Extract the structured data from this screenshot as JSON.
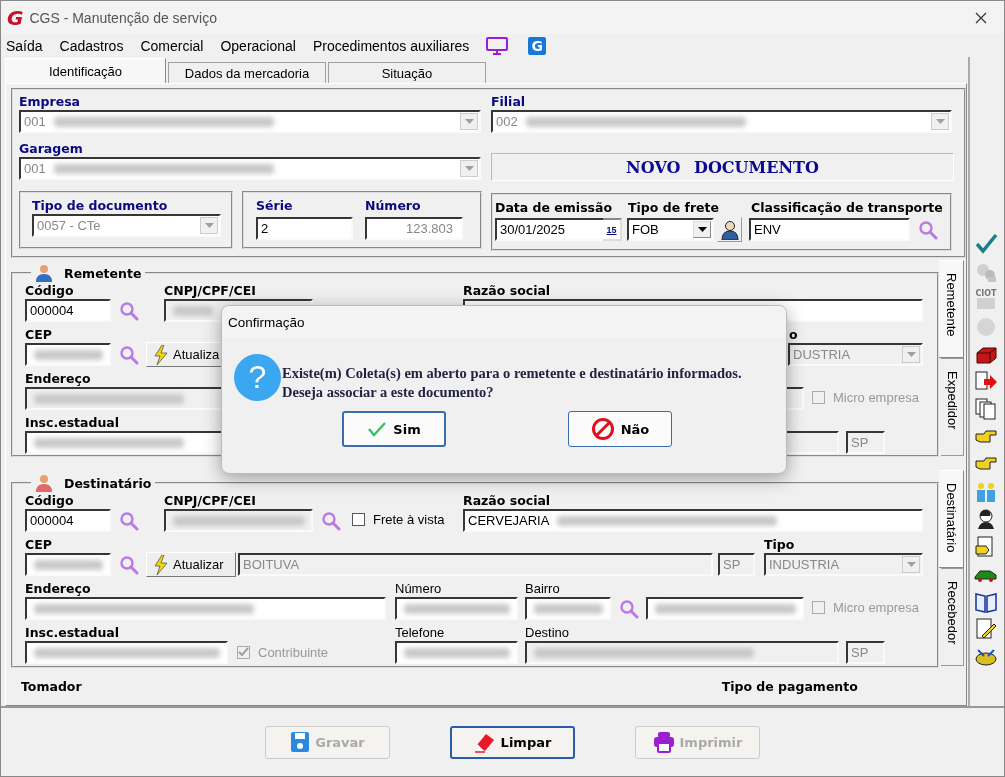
{
  "window": {
    "logo": "G",
    "title": "CGS - Manutenção de serviço"
  },
  "menu": [
    "Saída",
    "Cadastros",
    "Comercial",
    "Operacional",
    "Procedimentos auxiliares"
  ],
  "menu_logo": "G",
  "tabs": [
    {
      "label": "Identificação",
      "selected": true
    },
    {
      "label": "Dados da mercadoria",
      "selected": false
    },
    {
      "label": "Situação",
      "selected": false
    }
  ],
  "empresa": {
    "label": "Empresa",
    "field": {
      "value": "001",
      "redacted": true,
      "disabled": true
    }
  },
  "filial": {
    "label": "Filial",
    "field": {
      "value": "002",
      "redacted": true,
      "disabled": true
    }
  },
  "garagem": {
    "label": "Garagem",
    "field": {
      "value": "001",
      "redacted": true,
      "disabled": true
    }
  },
  "status_banner": "NOVO DOCUMENTO",
  "document_type": {
    "label": "Tipo de documento",
    "field": {
      "value": "0057 - CTe",
      "disabled": true
    }
  },
  "serie": {
    "label": "Série",
    "field": {
      "value": "2",
      "disabled": false
    }
  },
  "numero": {
    "label": "Número",
    "field": {
      "value": "123.803",
      "disabled": true
    }
  },
  "emission_date": {
    "label": "Data de emissão",
    "field": {
      "value": "30/01/2025",
      "disabled": false
    },
    "calendar_day": "15"
  },
  "freight_type": {
    "label": "Tipo de frete",
    "field": {
      "value": "FOB",
      "disabled": false
    }
  },
  "transport_class": {
    "label": "Classificação de transporte",
    "field": {
      "value": "ENV",
      "disabled": false
    }
  },
  "remetente": {
    "title": "Remetente",
    "codigo_label": "Código",
    "codigo": {
      "value": "000004",
      "disabled": false
    },
    "cnpj_label": "CNPJ/CPF/CEI",
    "cnpj": {
      "redacted": true,
      "disabled": true
    },
    "razao_label": "Razão social",
    "razao": {
      "disabled": false
    },
    "cep_label": "CEP",
    "cep": {
      "redacted": true,
      "disabled": false
    },
    "update_button": "Atualiza",
    "tipo_label": "o",
    "tipo": {
      "value": "DUSTRIA",
      "disabled": true
    },
    "endereco_label": "Endereço",
    "endereco": {
      "redacted": true,
      "disabled": true
    },
    "bairro_nome": {
      "disabled": true
    },
    "micro": {
      "label": "Micro empresa",
      "checked": false,
      "disabled": true
    },
    "insc_label": "Insc.estadual",
    "insc": {
      "redacted": true,
      "disabled": false
    },
    "destino": {
      "disabled": true
    },
    "uf": {
      "value": "SP",
      "disabled": true
    },
    "side_tabs": [
      {
        "label": "Remetente",
        "selected": true
      },
      {
        "label": "Expedidor",
        "selected": false
      }
    ]
  },
  "destinatario": {
    "title": "Destinatário",
    "codigo_label": "Código",
    "codigo": {
      "value": "000004",
      "disabled": false
    },
    "cnpj_label": "CNPJ/CPF/CEI",
    "cnpj": {
      "redacted": true,
      "disabled": true
    },
    "frete": {
      "label": "Frete à vista",
      "checked": false,
      "disabled": false
    },
    "razao_label": "Razão social",
    "razao": {
      "value": "CERVEJARIA",
      "redacted": true,
      "disabled": false
    },
    "cep_label": "CEP",
    "cep": {
      "redacted": true,
      "disabled": false
    },
    "update_button": "Atualizar",
    "cidade": {
      "value": "BOITUVA",
      "disabled": true
    },
    "cidade_uf": {
      "value": "SP",
      "disabled": true
    },
    "tipo_label": "Tipo",
    "tipo": {
      "value": "INDUSTRIA",
      "disabled": true
    },
    "endereco_label": "Endereço",
    "endereco": {
      "redacted": true,
      "disabled": false
    },
    "numero_label": "Número",
    "numero": {
      "redacted": true,
      "disabled": false
    },
    "bairro_label": "Bairro",
    "bairro": {
      "redacted": true,
      "disabled": false
    },
    "bairro_nome": {
      "redacted": true,
      "disabled": false
    },
    "micro": {
      "label": "Micro empresa",
      "checked": false,
      "disabled": true
    },
    "insc_label": "Insc.estadual",
    "insc": {
      "redacted": true,
      "disabled": false
    },
    "contribuinte": {
      "label": "Contribuinte",
      "checked": true,
      "disabled": true
    },
    "telefone_label": "Telefone",
    "telefone": {
      "redacted": true,
      "disabled": false
    },
    "destino_label": "Destino",
    "destino": {
      "redacted": true,
      "disabled": true
    },
    "uf": {
      "value": "SP",
      "disabled": true
    },
    "side_tabs": [
      {
        "label": "Destinatário",
        "selected": true
      },
      {
        "label": "Recebedor",
        "selected": false
      }
    ]
  },
  "tomador_label": "Tomador",
  "payment_label": "Tipo de pagamento",
  "toolbar": [
    {
      "kind": "check",
      "disabled": false
    },
    {
      "kind": "gears",
      "disabled": true
    },
    {
      "kind": "card",
      "label": "CIOT",
      "disabled": true
    },
    {
      "kind": "circle",
      "disabled": true
    },
    {
      "kind": "box",
      "disabled": false
    },
    {
      "kind": "doc-arrow",
      "disabled": false
    },
    {
      "kind": "docs",
      "disabled": false
    },
    {
      "kind": "hand",
      "disabled": false
    },
    {
      "kind": "hand",
      "disabled": false
    },
    {
      "kind": "people",
      "disabled": false
    },
    {
      "kind": "person",
      "disabled": false
    },
    {
      "kind": "doc-hand",
      "disabled": false
    },
    {
      "kind": "car",
      "disabled": false
    },
    {
      "kind": "book",
      "disabled": false
    },
    {
      "kind": "doc-pencil",
      "disabled": false
    },
    {
      "kind": "misc",
      "disabled": false
    }
  ],
  "buttons": [
    {
      "kind": "save",
      "label": "Gravar",
      "disabled": true
    },
    {
      "kind": "clear",
      "label": "Limpar",
      "disabled": false
    },
    {
      "kind": "print",
      "label": "Imprimir",
      "disabled": true
    }
  ],
  "dialog": {
    "title": "Confirmação",
    "icon": "?",
    "lines": [
      "Existe(m) Coleta(s) em aberto para o remetente e destinatário informados.",
      "Deseja associar a este documento?"
    ],
    "buttons": [
      {
        "kind": "yes",
        "label": "Sim",
        "default": true
      },
      {
        "kind": "no",
        "label": "Não",
        "default": false
      }
    ]
  }
}
